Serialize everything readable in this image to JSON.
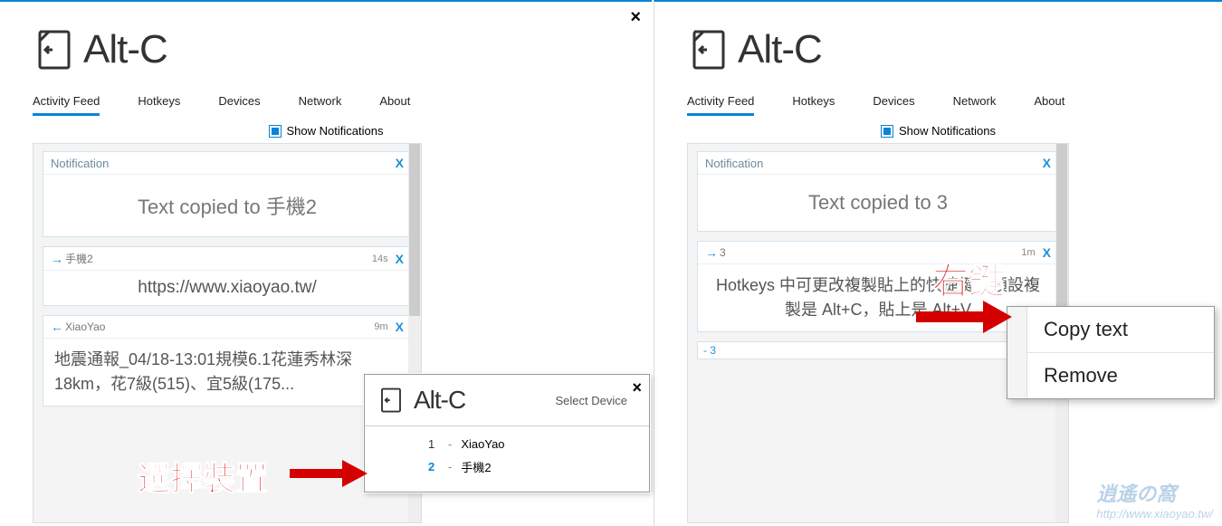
{
  "app": {
    "title": "Alt-C"
  },
  "tabs": [
    {
      "label": "Activity Feed",
      "active": true
    },
    {
      "label": "Hotkeys"
    },
    {
      "label": "Devices"
    },
    {
      "label": "Network"
    },
    {
      "label": "About"
    }
  ],
  "show_notifications_label": "Show Notifications",
  "left": {
    "notification": {
      "title": "Notification",
      "body": "Text copied to 手機2",
      "close": "X"
    },
    "items": [
      {
        "direction": "out",
        "device": "手機2",
        "time": "14s",
        "close": "X",
        "body": "https://www.xiaoyao.tw/"
      },
      {
        "direction": "in",
        "device": "XiaoYao",
        "time": "9m",
        "close": "X",
        "body": "地震通報_04/18-13:01規模6.1花蓮秀林深18km，花7級(515)、宜5級(175..."
      }
    ]
  },
  "right": {
    "notification": {
      "title": "Notification",
      "body": "Text copied to 3",
      "close": "X"
    },
    "items": [
      {
        "direction": "out",
        "device": "3",
        "time": "1m",
        "close": "X",
        "body": "Hotkeys 中可更改複製貼上的快捷鍵，預設複製是 Alt+C，貼上是 Alt+V"
      }
    ],
    "extra_head": "- 3"
  },
  "popup": {
    "title": "Select Device",
    "close": "×",
    "devices": [
      {
        "num": "1",
        "name": "XiaoYao"
      },
      {
        "num": "2",
        "name": "手機2"
      }
    ]
  },
  "context_menu": {
    "items": [
      {
        "label": "Copy text"
      },
      {
        "label": "Remove"
      }
    ]
  },
  "annotations": {
    "select_device": "選擇裝置",
    "right_click": "右鍵"
  },
  "watermark": {
    "name": "逍遙の窩",
    "url": "http://www.xiaoyao.tw/"
  },
  "colors": {
    "accent": "#0b84d6",
    "danger": "#d40000"
  }
}
